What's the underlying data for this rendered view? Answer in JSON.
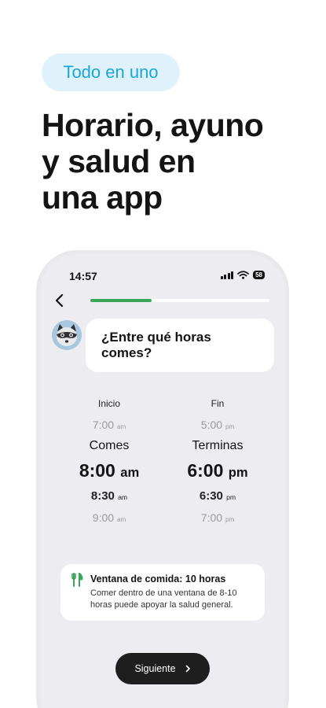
{
  "badge": {
    "label": "Todo en uno"
  },
  "headline": {
    "lines": [
      "Horario, ayuno",
      "y salud en",
      "una app"
    ]
  },
  "status_bar": {
    "time": "14:57",
    "battery": "58"
  },
  "progress": {
    "fraction": 0.34
  },
  "question": {
    "text": "¿Entre qué horas comes?"
  },
  "picker": {
    "start": {
      "label": "Inicio",
      "caption": "Comes",
      "options": [
        {
          "time": "7:00",
          "unit": "am"
        },
        {
          "time": "8:00",
          "unit": "am"
        },
        {
          "time": "8:30",
          "unit": "am"
        },
        {
          "time": "9:00",
          "unit": "am"
        }
      ]
    },
    "end": {
      "label": "Fin",
      "caption": "Terminas",
      "options": [
        {
          "time": "5:00",
          "unit": "pm"
        },
        {
          "time": "6:00",
          "unit": "pm"
        },
        {
          "time": "6:30",
          "unit": "pm"
        },
        {
          "time": "7:00",
          "unit": "pm"
        }
      ]
    }
  },
  "info": {
    "icon": "fork-knife-icon",
    "title": "Ventana de comida: 10 horas",
    "body": "Comer dentro de una ventana de 8-10 horas puede apoyar la salud general."
  },
  "next_button": {
    "label": "Siguiente",
    "icon": "chevron-right-icon"
  },
  "colors": {
    "accent_blue": "#1aa6d9",
    "badge_bg": "#dff2fb",
    "progress_green": "#3aa65a",
    "button_dark": "#1e1e1e"
  }
}
